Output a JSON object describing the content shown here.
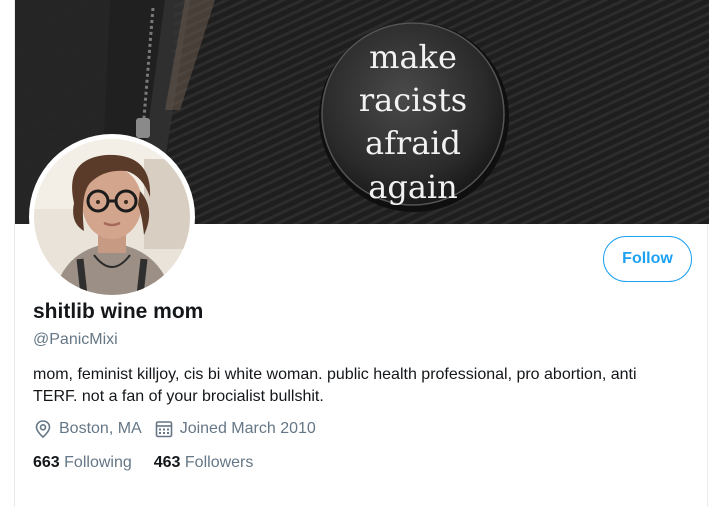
{
  "banner": {
    "button_text_lines": [
      "make",
      "racists",
      "afraid",
      "again"
    ]
  },
  "profile": {
    "display_name": "shitlib wine mom",
    "handle": "@PanicMixi",
    "bio": "mom, feminist killjoy, cis bi white woman. public health professional, pro abortion, anti TERF. not a fan of your brocialist bullshit.",
    "location": "Boston, MA",
    "joined": "Joined March 2010",
    "following_count": "663",
    "following_label": "Following",
    "followers_count": "463",
    "followers_label": "Followers"
  },
  "actions": {
    "follow_label": "Follow"
  },
  "colors": {
    "accent": "#1da1f2",
    "secondary_text": "#657786",
    "primary_text": "#14171a"
  },
  "icons": {
    "location": "location-pin-icon",
    "joined": "calendar-icon"
  }
}
